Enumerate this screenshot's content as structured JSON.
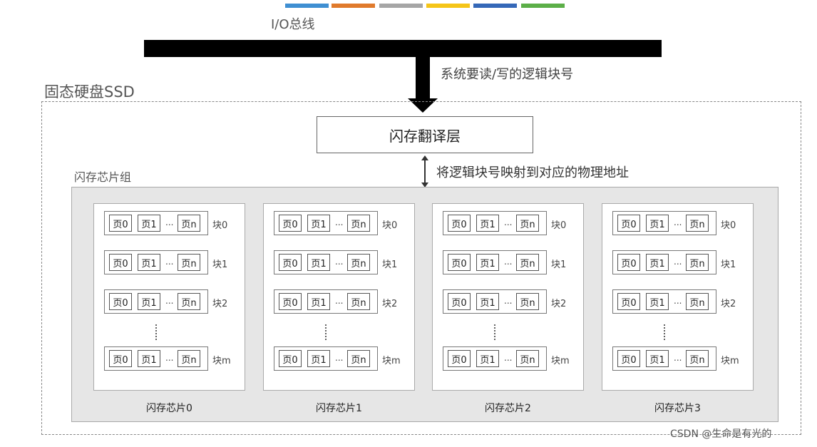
{
  "colors": [
    "#3f8fd2",
    "#e07a2c",
    "#a6a6a6",
    "#f5c518",
    "#3568b8",
    "#5caf48"
  ],
  "bus_label": "I/O总线",
  "arrow_label": "系统要读/写的逻辑块号",
  "ssd_label": "固态硬盘SSD",
  "ftl_label": "闪存翻译层",
  "map_label": "将逻辑块号映射到对应的物理地址",
  "group_label": "闪存芯片组",
  "page_labels": [
    "页0",
    "页1",
    "...",
    "页n"
  ],
  "block_labels": [
    "块0",
    "块1",
    "块2",
    "块m"
  ],
  "chips": [
    "闪存芯片0",
    "闪存芯片1",
    "闪存芯片2",
    "闪存芯片3"
  ],
  "credit": "CSDN @生命是有光的"
}
